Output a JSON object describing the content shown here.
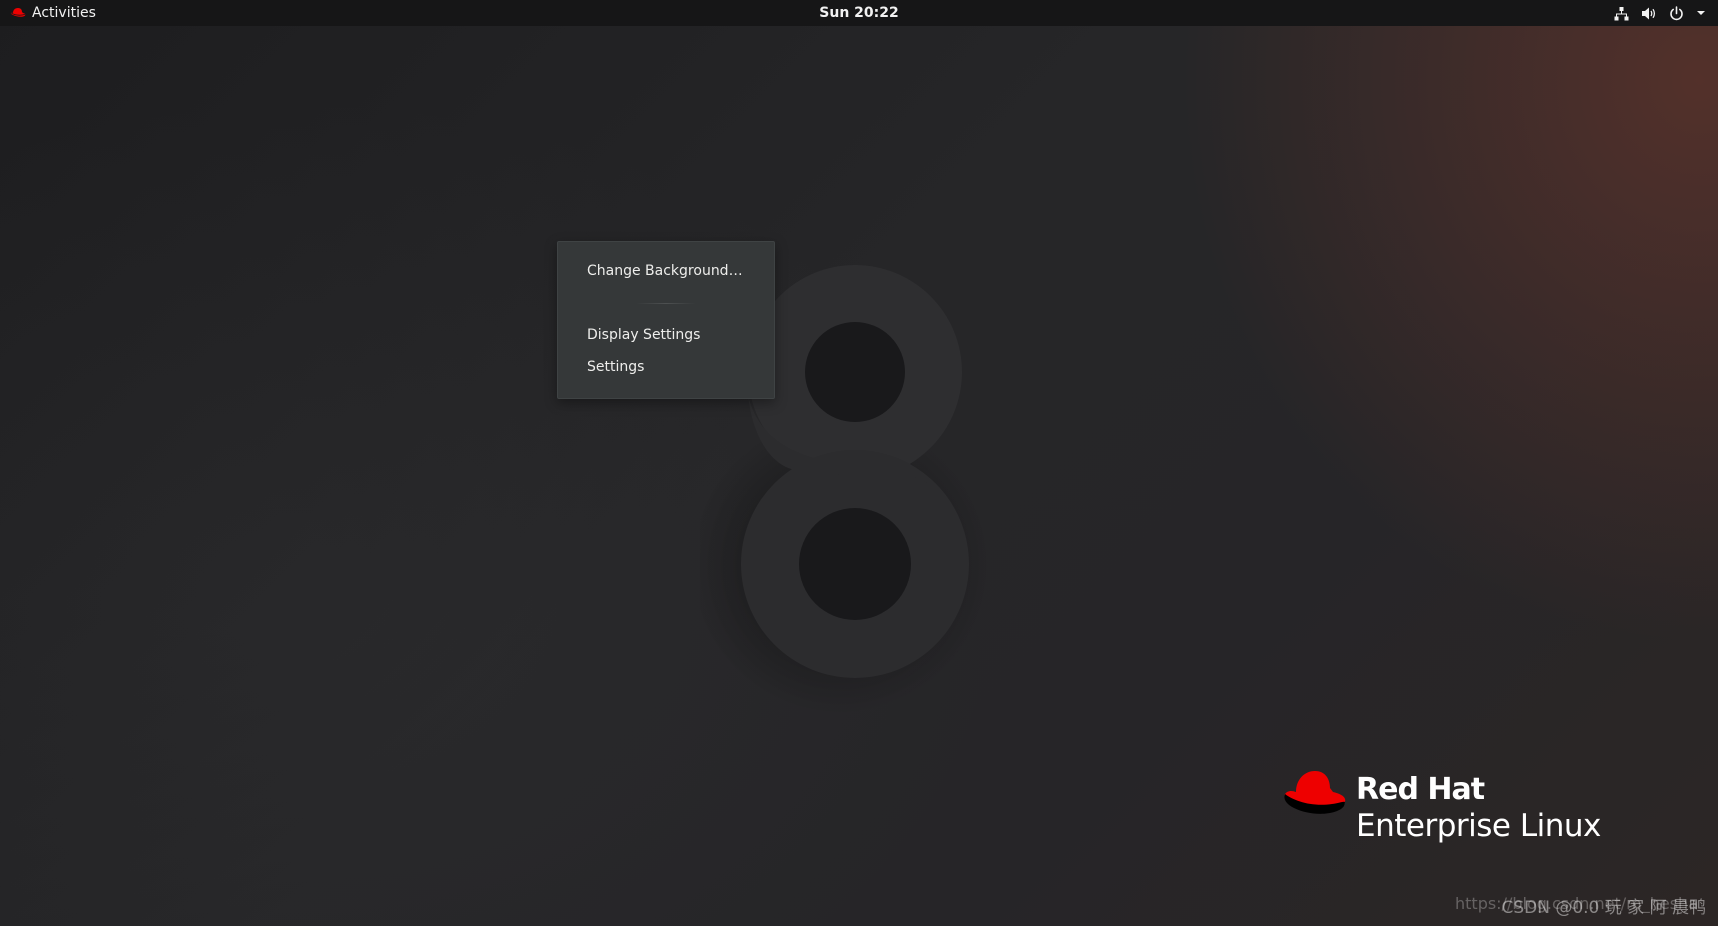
{
  "topbar": {
    "activities_label": "Activities",
    "clock": "Sun 20:22",
    "tray_icons": [
      "network-icon",
      "volume-icon",
      "power-icon",
      "chevron-down-icon"
    ]
  },
  "context_menu": {
    "items": [
      {
        "label": "Change Background…"
      },
      {
        "label": "Display Settings"
      },
      {
        "label": "Settings"
      }
    ]
  },
  "brand": {
    "line1": "Red Hat",
    "line2": "Enterprise Linux",
    "accent": "#ee0000"
  },
  "watermark": {
    "text_front": "CSDN @0.0 玩 家 阿 晨鸭",
    "text_back": "https://blog.csdn.net/m_hesha"
  },
  "colors": {
    "topbar_bg": "#161617",
    "menu_bg": "#353839",
    "wallpaper_accent": "#7a3a2c"
  }
}
